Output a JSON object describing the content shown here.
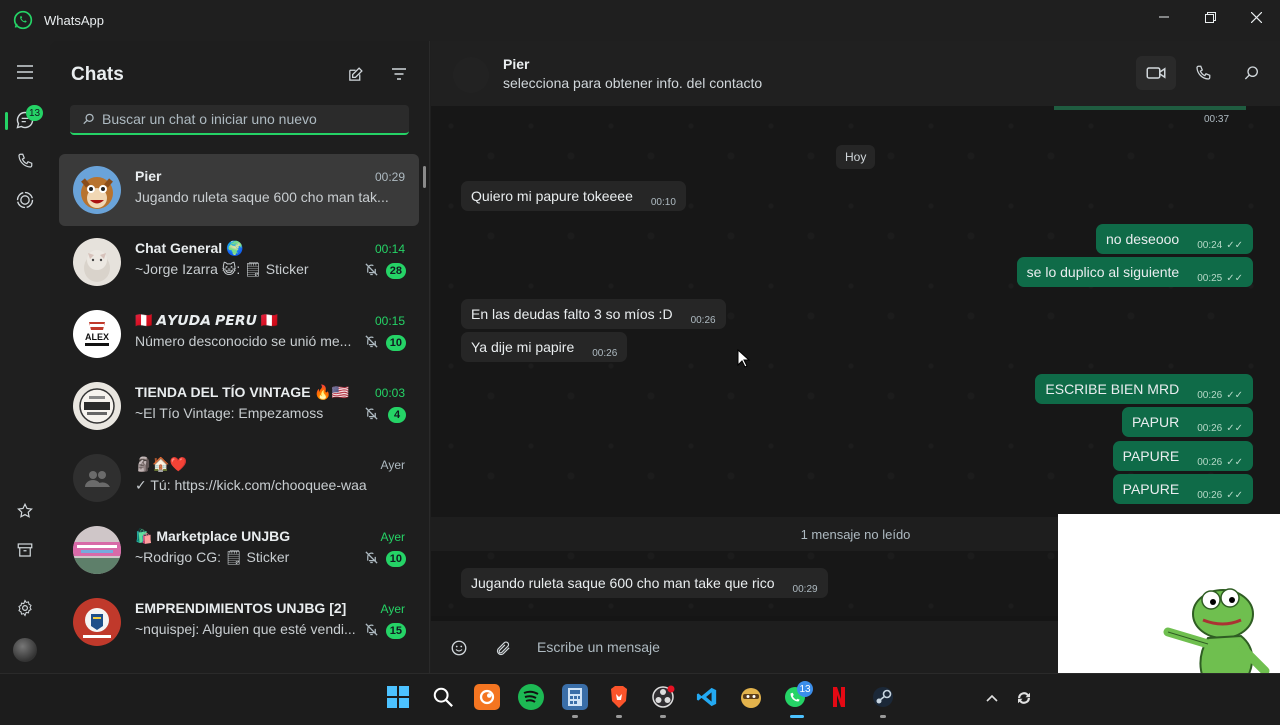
{
  "window": {
    "app_name": "WhatsApp"
  },
  "rail": {
    "chats_badge": "13"
  },
  "sidebar": {
    "title": "Chats",
    "search_placeholder": "Buscar un chat o iniciar uno nuevo",
    "chats": [
      {
        "name": "Pier",
        "time": "00:29",
        "preview": "Jugando ruleta saque 600 cho man tak...",
        "count": "",
        "muted": false,
        "time_green": false
      },
      {
        "name": "Chat General 🌍",
        "time": "00:14",
        "preview": "~Jorge Izarra 😺: 🗒 Sticker",
        "count": "28",
        "muted": true,
        "time_green": true
      },
      {
        "name": "🇵🇪 𝘼𝙔𝙐𝘿𝘼 𝙋𝙀𝙍𝙐 🇵🇪",
        "time": "00:15",
        "preview": "Número desconocido se unió me...",
        "count": "10",
        "muted": true,
        "time_green": true
      },
      {
        "name": "TIENDA DEL TÍO VINTAGE 🔥🇺🇸",
        "time": "00:03",
        "preview": "~El Tío Vintage: Empezamoss",
        "count": "4",
        "muted": true,
        "time_green": true
      },
      {
        "name": "🗿🏠❤️",
        "time": "Ayer",
        "preview": "✓ Tú: https://kick.com/chooquee-waa",
        "count": "",
        "muted": false,
        "time_green": false
      },
      {
        "name": "🛍️ Marketplace UNJBG",
        "time": "Ayer",
        "preview": "~Rodrigo CG: 🗒 Sticker",
        "count": "10",
        "muted": true,
        "time_green": true
      },
      {
        "name": "EMPRENDIMIENTOS UNJBG [2]",
        "time": "Ayer",
        "preview": "~nquispej: Alguien que esté vendi...",
        "count": "15",
        "muted": true,
        "time_green": true
      }
    ]
  },
  "conversation": {
    "contact_name": "Pier",
    "contact_subtitle": "selecciona para obtener info. del contacto",
    "top_time": "00:37",
    "day_label": "Hoy",
    "messages": [
      {
        "text": "Quiero mi papure tokeeee",
        "time": "00:10",
        "dir": "in"
      },
      {
        "text": "no deseooo",
        "time": "00:24",
        "dir": "out"
      },
      {
        "text": "se lo duplico al siguiente",
        "time": "00:25",
        "dir": "out"
      },
      {
        "text": "En las deudas falto 3 so míos :D",
        "time": "00:26",
        "dir": "in"
      },
      {
        "text": "Ya dije mi papire",
        "time": "00:26",
        "dir": "in"
      },
      {
        "text": "ESCRIBE BIEN MRD",
        "time": "00:26",
        "dir": "out"
      },
      {
        "text": "PAPUR",
        "time": "00:26",
        "dir": "out"
      },
      {
        "text": "PAPURE",
        "time": "00:26",
        "dir": "out"
      },
      {
        "text": "PAPURE",
        "time": "00:26",
        "dir": "out"
      },
      {
        "text": "Jugando ruleta saque 600 cho man take que rico",
        "time": "00:29",
        "dir": "in"
      }
    ],
    "unread_label": "1 mensaje no leído",
    "composer_placeholder": "Escribe un mensaje"
  },
  "taskbar": {
    "whatsapp_badge": "13",
    "icons": [
      "windows-start-icon",
      "search-icon",
      "crunchyroll-icon",
      "spotify-icon",
      "calculator-icon",
      "brave-icon",
      "obs-icon",
      "vscode-icon",
      "game-icon",
      "whatsapp-icon",
      "netflix-icon",
      "steam-icon"
    ]
  },
  "colors": {
    "accent": "#25d366",
    "outgoing_bubble": "#0f6b48",
    "incoming_bubble": "#262626"
  }
}
